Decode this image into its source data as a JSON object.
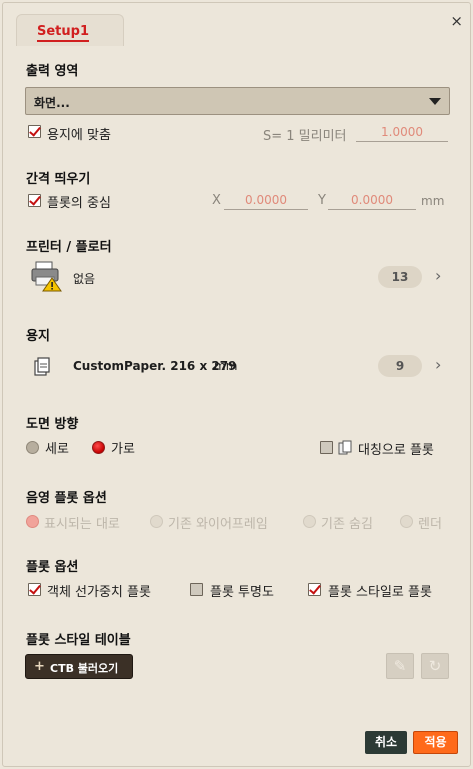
{
  "tab": {
    "label": "Setup1"
  },
  "close_glyph": "×",
  "output_area": {
    "title": "출력 영역",
    "dropdown_value": "화면...",
    "fit_paper_label": "용지에 맞춤",
    "scale_label": "S= 1 밀리미터",
    "scale_value": "1.0000"
  },
  "offset": {
    "title": "간격 띄우기",
    "center_label": "플롯의 중심",
    "x_label": "X",
    "x_value": "0.0000",
    "y_label": "Y",
    "y_value": "0.0000",
    "unit": "mm"
  },
  "printer": {
    "title": "프린터 / 플로터",
    "icon": "printer-warning-icon",
    "name": "없음",
    "count": "13"
  },
  "paper": {
    "title": "용지",
    "icon": "paper-icon",
    "name": "CustomPaper. 216 x 279",
    "unit": "mm",
    "count": "9"
  },
  "orientation": {
    "title": "도면 방향",
    "portrait": "세로",
    "landscape": "가로",
    "reverse": "대칭으로 플롯"
  },
  "shade": {
    "title": "음영 플롯 옵션",
    "options": [
      "표시되는 대로",
      "기존 와이어프레임",
      "기존 숨김",
      "렌더"
    ]
  },
  "plot_options": {
    "title": "플롯 옵션",
    "lineweights": "객체 선가중치 플롯",
    "transparency": "플롯 투명도",
    "styles": "플롯 스타일로 플롯"
  },
  "style_table": {
    "title": "플롯 스타일 테이블",
    "load_button": "CTB 불러오기",
    "plus": "+"
  },
  "footer": {
    "cancel": "취소",
    "apply": "적용"
  },
  "colors": {
    "accent": "#d11f1f",
    "apply": "#ff6a1a",
    "cancel": "#2c3a35"
  }
}
